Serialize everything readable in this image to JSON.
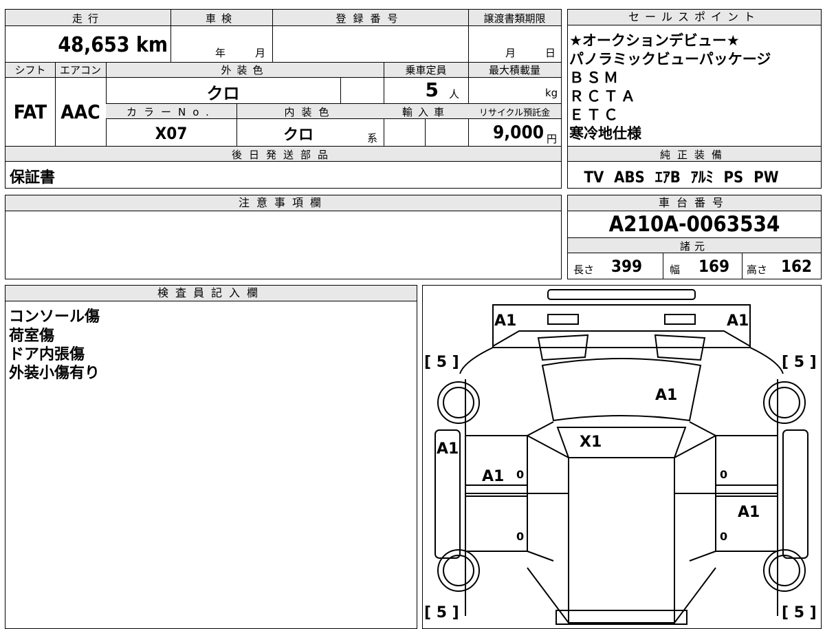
{
  "top_table": {
    "h_mileage": "走行",
    "h_shaken": "車検",
    "h_reg_no": "登録番号",
    "h_transfer_deadline": "譲渡書類期限",
    "mileage": "48,653 km",
    "shaken_year": "年",
    "shaken_month": "月",
    "transfer_month": "月",
    "transfer_day": "日",
    "h_shift": "シフト",
    "h_aircon": "エアコン",
    "h_ext_color": "外装色",
    "h_capacity": "乗車定員",
    "h_max_load": "最大積載量",
    "shift": "FAT",
    "aircon": "AAC",
    "ext_color": "クロ",
    "capacity": "5",
    "capacity_unit": "人",
    "load_unit": "kg",
    "h_color_no": "カラーNo.",
    "h_int_color": "内装色",
    "h_import": "輸入車",
    "h_recycle": "リサイクル預託金",
    "color_no": "X07",
    "int_color": "クロ",
    "int_color_suffix": "系",
    "recycle_fee": "9,000",
    "recycle_unit": "円",
    "h_later_parts": "後日発送部品",
    "later_parts": "保証書"
  },
  "sales_points": {
    "header": "セールスポイント",
    "lines": [
      "★オークションデビュー★",
      "パノラミックビューパッケージ",
      "ＢＳＭ",
      "ＲＣＴＡ",
      "ＥＴＣ",
      "寒冷地仕様"
    ]
  },
  "equipment": {
    "header": "純正装備",
    "items": "TV ABS ｴｱB ｱﾙﾐ PS PW"
  },
  "notes": {
    "header": "注意事項欄",
    "content": ""
  },
  "chassis": {
    "header": "車台番号",
    "number": "A210A-0063534",
    "spec_header": "諸元",
    "length_label": "長さ",
    "length": "399",
    "width_label": "幅",
    "width": "169",
    "height_label": "高さ",
    "height": "162"
  },
  "inspector": {
    "header": "検査員記入欄",
    "lines": [
      "コンソール傷",
      "荷室傷",
      "ドア内張傷",
      "外装小傷有り"
    ]
  },
  "diagram": {
    "tyre_fl": "[ 5 ]",
    "tyre_fr": "[ 5 ]",
    "tyre_rl": "[ 5 ]",
    "tyre_rr": "[ 5 ]",
    "front_left": "A1",
    "front_right": "A1",
    "windshield": "A1",
    "roof": "X1",
    "left_fender": "A1",
    "left_front_door": "A1",
    "right_rear_door": "A1",
    "door_lf": "0",
    "door_lr": "0",
    "door_rf": "0",
    "door_rr": "0"
  }
}
